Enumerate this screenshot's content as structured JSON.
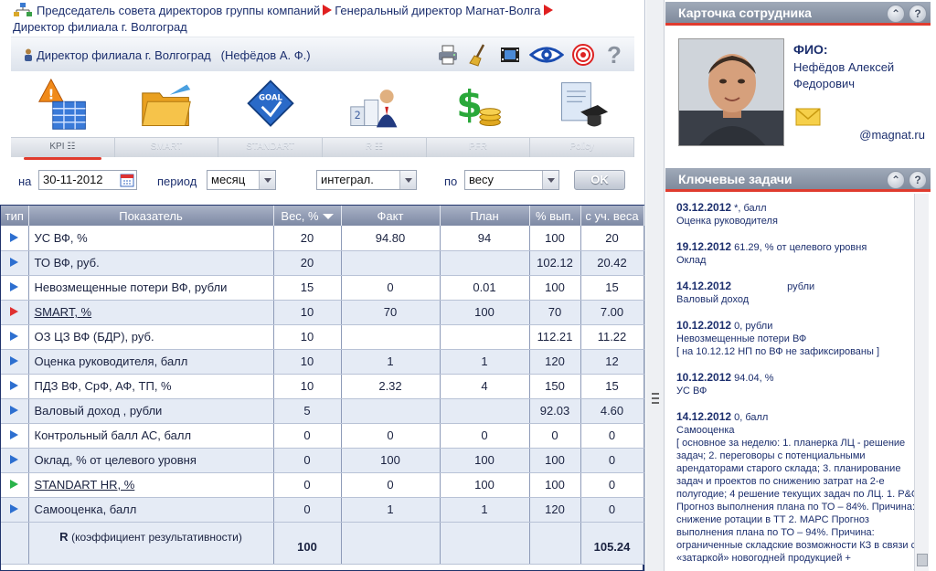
{
  "breadcrumb": {
    "part1": "Председатель совета директоров группы компаний",
    "part2": "Генеральный директор Магнат-Волга",
    "part3": "Директор филиала г. Волгоград"
  },
  "titlebar": {
    "title": "Директор филиала г. Волгоград",
    "person": "(Нефёдов А. Ф.)"
  },
  "tabs": [
    "KPI ☷",
    "SMART",
    "STANDART",
    "R ☷",
    "PFR",
    "Policy"
  ],
  "filters": {
    "date_label": "на",
    "date_value": "30-11-2012",
    "period_label": "период",
    "period_value": "месяц",
    "mode_value": "интеграл.",
    "by_label": "по",
    "by_value": "весу",
    "ok_label": "OK"
  },
  "table": {
    "headers": [
      "тип",
      "Показатель",
      "Вес, %",
      "Факт",
      "План",
      "% вып.",
      "с уч. веса"
    ],
    "rows": [
      {
        "name": "УС ВФ, %",
        "link": false,
        "type": "blue",
        "weight": "20",
        "fact": "94.80",
        "plan": "94",
        "pct": "100",
        "wpct": "20"
      },
      {
        "name": "ТО ВФ, руб.",
        "link": false,
        "type": "blue",
        "weight": "20",
        "fact": "",
        "plan": "",
        "pct": "102.12",
        "wpct": "20.42"
      },
      {
        "name": "Невозмещенные потери ВФ, рубли",
        "link": false,
        "type": "blue",
        "weight": "15",
        "fact": "0",
        "plan": "0.01",
        "pct": "100",
        "wpct": "15"
      },
      {
        "name": "SMART, %",
        "link": true,
        "type": "red",
        "weight": "10",
        "fact": "70",
        "plan": "100",
        "pct": "70",
        "wpct": "7.00"
      },
      {
        "name": "ОЗ ЦЗ ВФ (БДР), руб.",
        "link": false,
        "type": "blue",
        "weight": "10",
        "fact": "",
        "plan": "",
        "pct": "112.21",
        "wpct": "11.22"
      },
      {
        "name": "Оценка руководителя, балл",
        "link": false,
        "type": "blue",
        "weight": "10",
        "fact": "1",
        "plan": "1",
        "pct": "120",
        "wpct": "12"
      },
      {
        "name": "ПДЗ ВФ, СрФ, АФ, ТП, %",
        "link": false,
        "type": "blue",
        "weight": "10",
        "fact": "2.32",
        "plan": "4",
        "pct": "150",
        "wpct": "15"
      },
      {
        "name": "Валовый доход , рубли",
        "link": false,
        "type": "blue",
        "weight": "5",
        "fact": "",
        "plan": "",
        "pct": "92.03",
        "wpct": "4.60"
      },
      {
        "name": "Контрольный балл АС, балл",
        "link": false,
        "type": "blue",
        "weight": "0",
        "fact": "0",
        "plan": "0",
        "pct": "0",
        "wpct": "0"
      },
      {
        "name": "Оклад, % от целевого уровня",
        "link": false,
        "type": "blue",
        "weight": "0",
        "fact": "100",
        "plan": "100",
        "pct": "100",
        "wpct": "0"
      },
      {
        "name": "STANDART HR, %",
        "link": true,
        "type": "green",
        "weight": "0",
        "fact": "0",
        "plan": "100",
        "pct": "100",
        "wpct": "0"
      },
      {
        "name": "Самооценка, балл",
        "link": false,
        "type": "blue",
        "weight": "0",
        "fact": "1",
        "plan": "1",
        "pct": "120",
        "wpct": "0"
      }
    ],
    "total": {
      "label_r": "R",
      "label_rest": "(коэффициент результативности)",
      "weight": "100",
      "wpct": "105.24"
    }
  },
  "card": {
    "header": "Карточка сотрудника",
    "fio_label": "ФИО:",
    "name_line1": "Нефёдов Алексей",
    "name_line2": "Федорович",
    "email": "@magnat.ru"
  },
  "tasks": {
    "header": "Ключевые задачи",
    "items": [
      {
        "date": "03.12.2012",
        "tail": " *, балл",
        "title": "Оценка руководителя",
        "note": ""
      },
      {
        "date": "19.12.2012",
        "tail": " 61.29, % от целевого уровня",
        "title": "Оклад",
        "note": ""
      },
      {
        "date": "14.12.2012",
        "tail": "                    рубли",
        "title": "Валовый доход",
        "note": ""
      },
      {
        "date": "10.12.2012",
        "tail": " 0, рубли",
        "title": "Невозмещенные потери ВФ",
        "note": "[ на 10.12.12 НП по ВФ не зафиксированы ]"
      },
      {
        "date": "10.12.2012",
        "tail": " 94.04, %",
        "title": "УС ВФ",
        "note": ""
      },
      {
        "date": "14.12.2012",
        "tail": " 0, балл",
        "title": "Самооценка",
        "note": "[ основное за неделю: 1. планерка ЛЦ - решение задач; 2. переговоры с потенциальными арендаторами старого склада; 3. планирование задач и проектов по снижению затрат на 2-е полугодие; 4 решение текущих задач по ЛЦ. 1. P&G Прогноз выполнения плана по ТО – 84%. Причина: снижение ротации в ТТ 2. МАРС Прогноз выполнения плана по ТО – 94%. Причина: ограниченные складские возможности КЗ в связи с «затаркой» новогодней продукцией +"
      }
    ]
  },
  "colors": {
    "accent_red": "#e03b2e",
    "header_blue": "#7d89a4",
    "text_navy": "#1c2f6e"
  }
}
